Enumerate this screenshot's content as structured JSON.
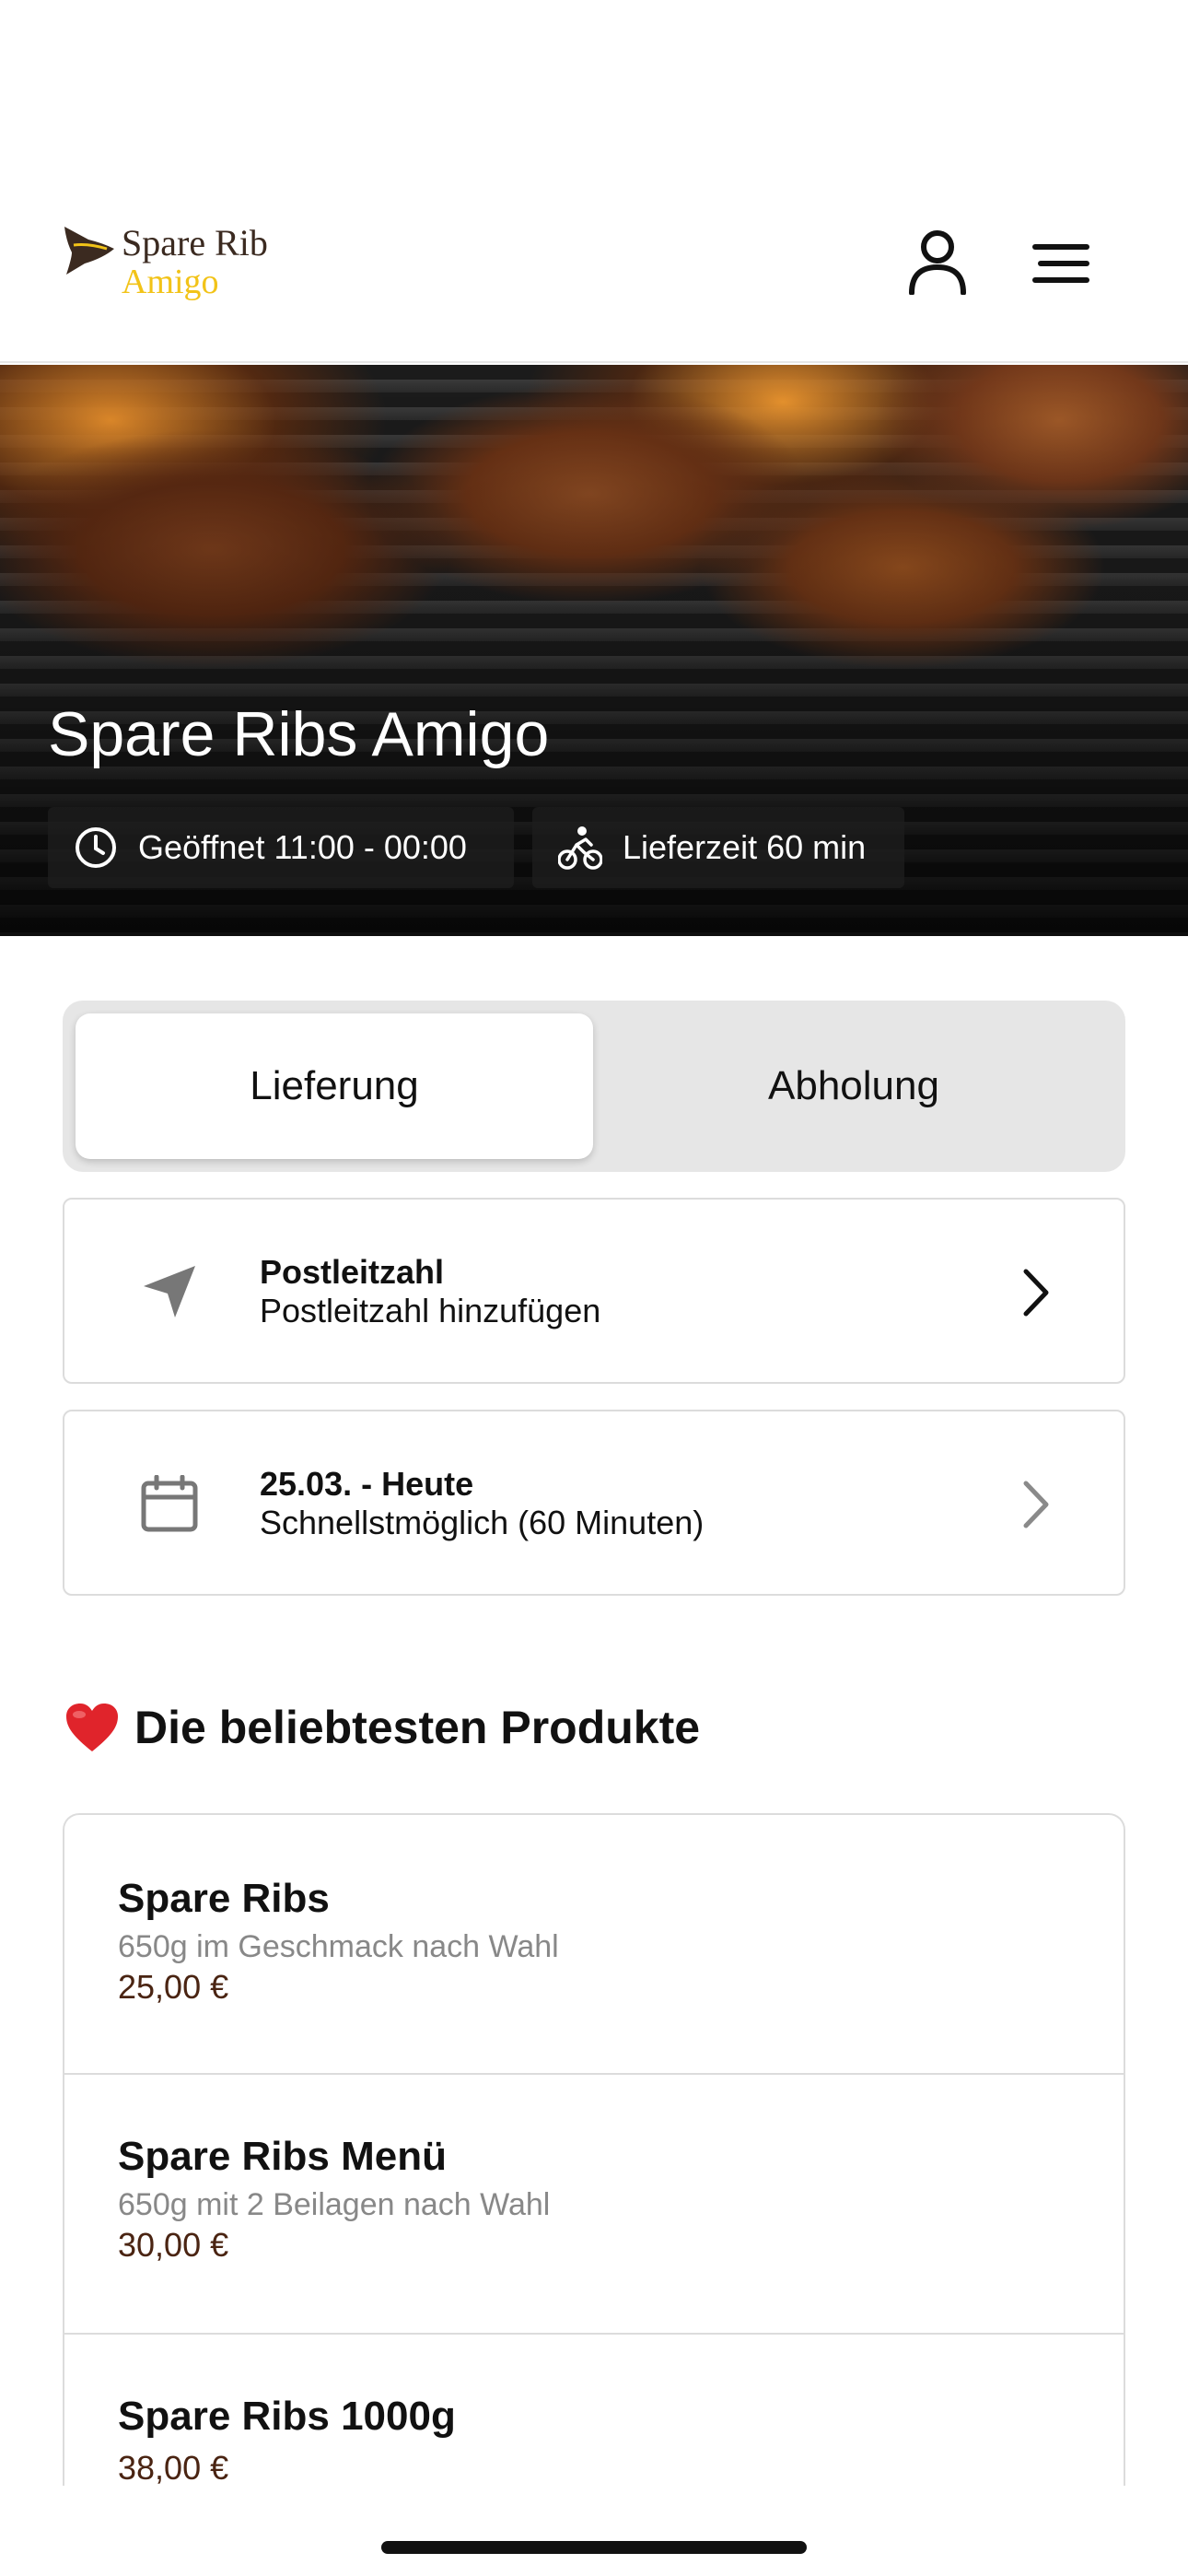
{
  "header": {
    "logo": {
      "line1": "Spare Rib",
      "line2": "Amigo"
    },
    "user_icon": "user-icon",
    "menu_icon": "hamburger-menu-icon"
  },
  "hero": {
    "title": "Spare Ribs Amigo",
    "opening_hours": "Geöffnet 11:00 - 00:00",
    "delivery_time": "Lieferzeit 60 min"
  },
  "order_mode": {
    "options": [
      {
        "label": "Lieferung",
        "selected": true
      },
      {
        "label": "Abholung",
        "selected": false
      }
    ]
  },
  "postal_card": {
    "title": "Postleitzahl",
    "subtitle": "Postleitzahl hinzufügen",
    "icon": "location-arrow-icon"
  },
  "date_card": {
    "title": "25.03. - Heute",
    "subtitle": "Schnellstmöglich (60 Minuten)",
    "icon": "calendar-icon"
  },
  "popular": {
    "heading": "Die beliebtesten Produkte",
    "icon": "heart-icon",
    "items": [
      {
        "name": "Spare Ribs",
        "description": "650g im Geschmack nach Wahl",
        "price": "25,00 €"
      },
      {
        "name": "Spare Ribs Menü",
        "description": "650g mit 2 Beilagen nach Wahl",
        "price": "30,00 €"
      },
      {
        "name": "Spare Ribs 1000g",
        "description": "",
        "price": "38,00 €"
      }
    ]
  },
  "colors": {
    "brand_gold": "#f2c318",
    "brand_brown": "#3b2a20",
    "price_brown": "#4a2412",
    "heart_red": "#e0242b"
  }
}
